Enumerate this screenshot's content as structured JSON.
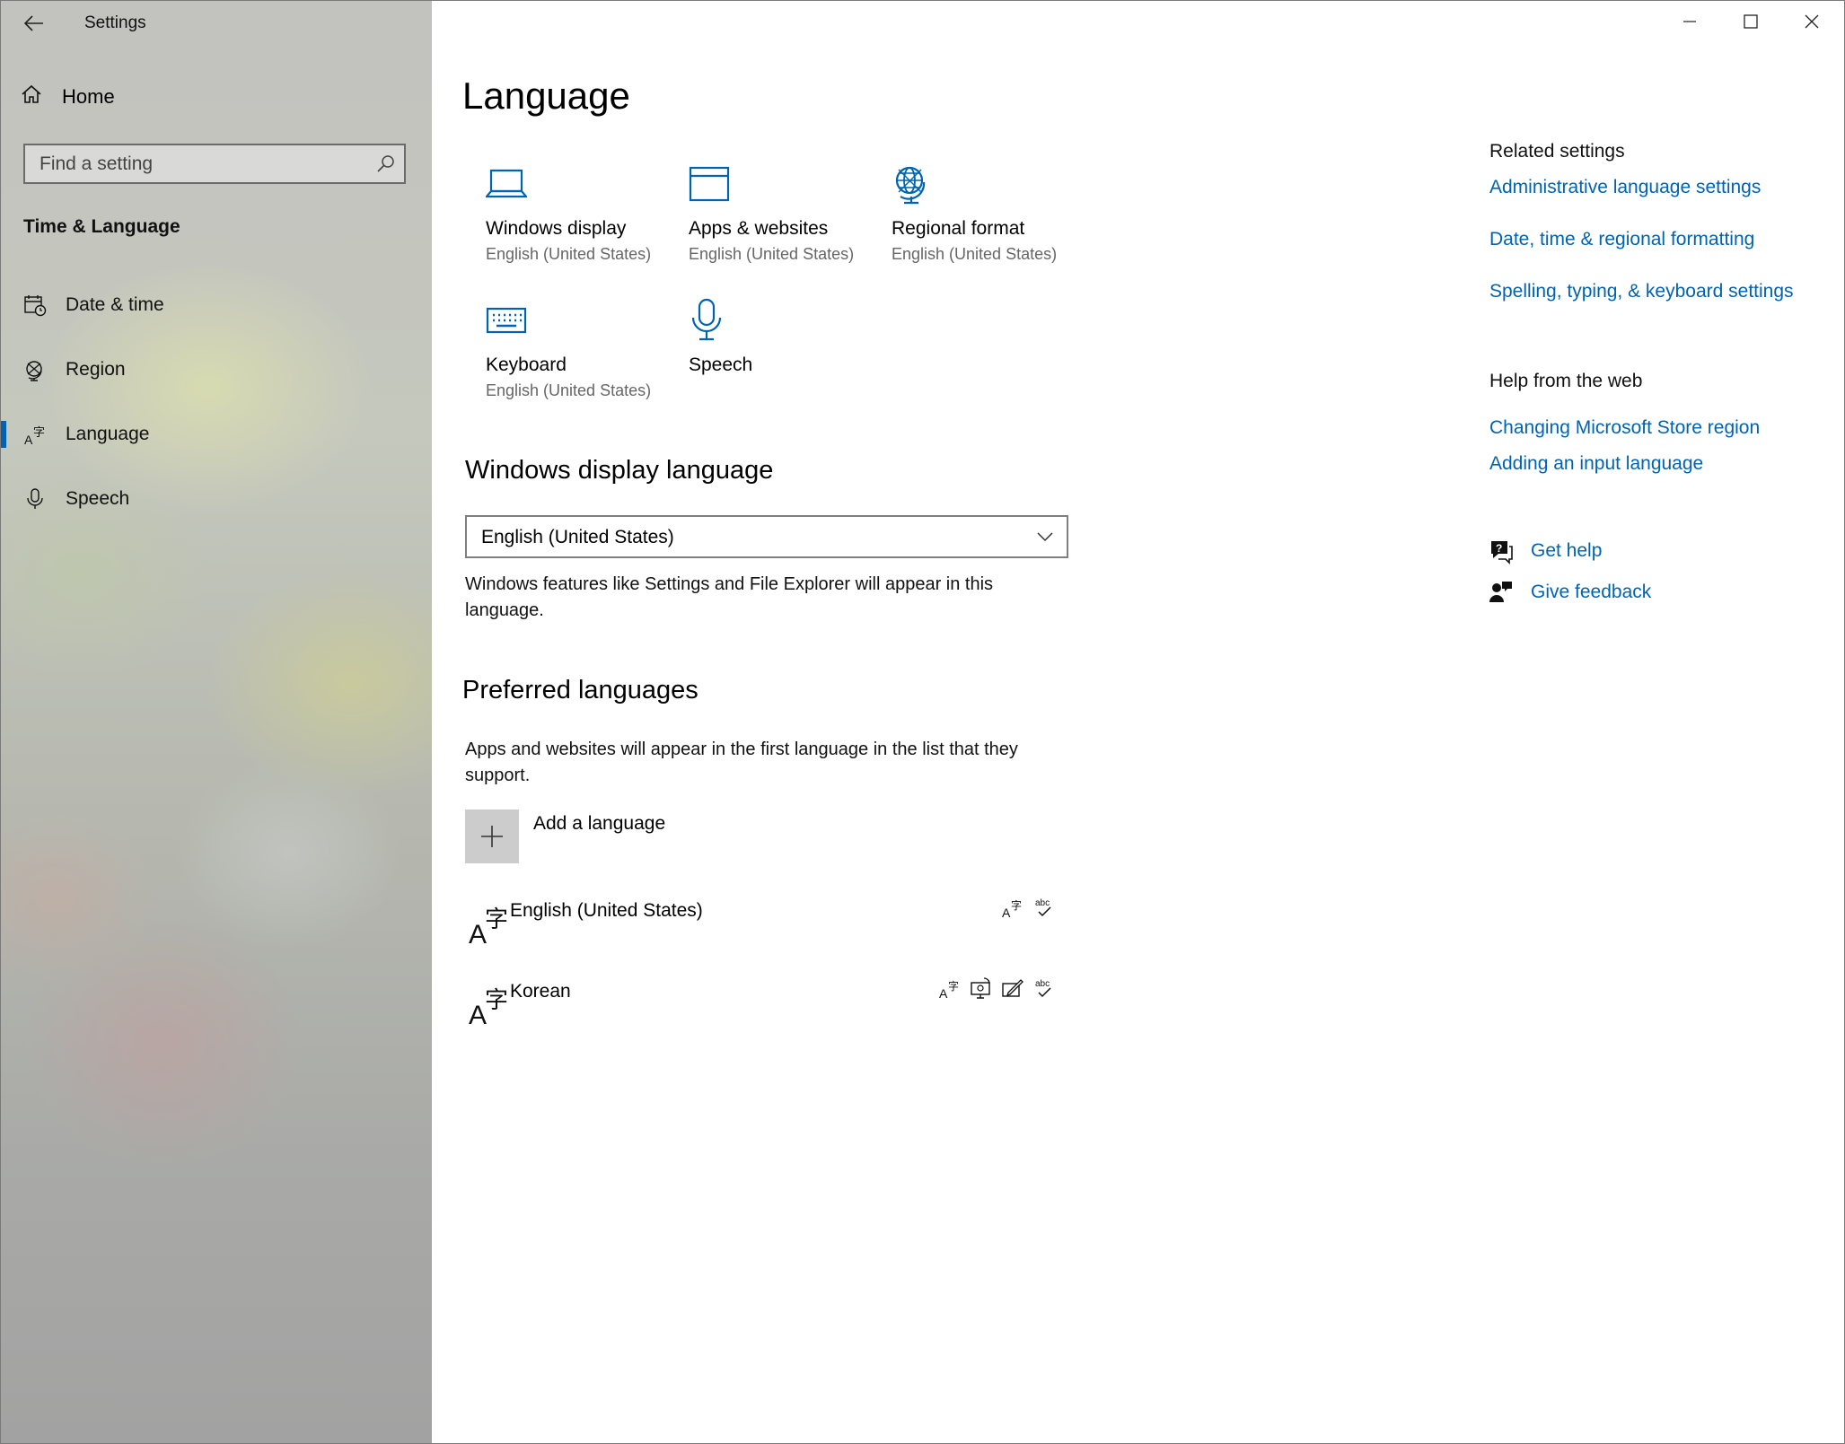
{
  "window": {
    "title": "Settings",
    "back_icon": "back-arrow-icon",
    "controls": [
      "minimize",
      "maximize",
      "close"
    ]
  },
  "sidebar": {
    "home_label": "Home",
    "search_placeholder": "Find a setting",
    "section_title": "Time & Language",
    "items": [
      {
        "label": "Date & time",
        "icon": "calendar-clock-icon",
        "active": false
      },
      {
        "label": "Region",
        "icon": "globe-region-icon",
        "active": false
      },
      {
        "label": "Language",
        "icon": "language-icon",
        "active": true
      },
      {
        "label": "Speech",
        "icon": "microphone-icon",
        "active": false
      }
    ]
  },
  "main": {
    "title": "Language",
    "tiles": [
      {
        "title": "Windows display",
        "subtitle": "English (United States)",
        "icon": "laptop-icon"
      },
      {
        "title": "Apps & websites",
        "subtitle": "English (United States)",
        "icon": "browser-window-icon"
      },
      {
        "title": "Regional format",
        "subtitle": "English (United States)",
        "icon": "globe-icon"
      },
      {
        "title": "Keyboard",
        "subtitle": "English (United States)",
        "icon": "keyboard-icon"
      },
      {
        "title": "Speech",
        "subtitle": "",
        "icon": "microphone-icon"
      }
    ],
    "display_language": {
      "heading": "Windows display language",
      "selected": "English (United States)",
      "description": "Windows features like Settings and File Explorer will appear in this language."
    },
    "preferred": {
      "heading": "Preferred languages",
      "description": "Apps and websites will appear in the first language in the list that they support.",
      "add_label": "Add a language",
      "languages": [
        {
          "name": "English (United States)",
          "features": [
            "display-language-icon",
            "spelling-icon"
          ]
        },
        {
          "name": "Korean",
          "features": [
            "display-language-icon",
            "speech-icon",
            "handwriting-icon",
            "spelling-icon"
          ]
        }
      ]
    }
  },
  "right": {
    "related_heading": "Related settings",
    "related_links": [
      "Administrative language settings",
      "Date, time & regional formatting",
      "Spelling, typing, & keyboard settings"
    ],
    "help_heading": "Help from the web",
    "help_links": [
      "Changing Microsoft Store region",
      "Adding an input language"
    ],
    "get_help": "Get help",
    "give_feedback": "Give feedback"
  },
  "colors": {
    "accent": "#0063b1",
    "link": "#0063b1",
    "subtext": "#666666"
  }
}
